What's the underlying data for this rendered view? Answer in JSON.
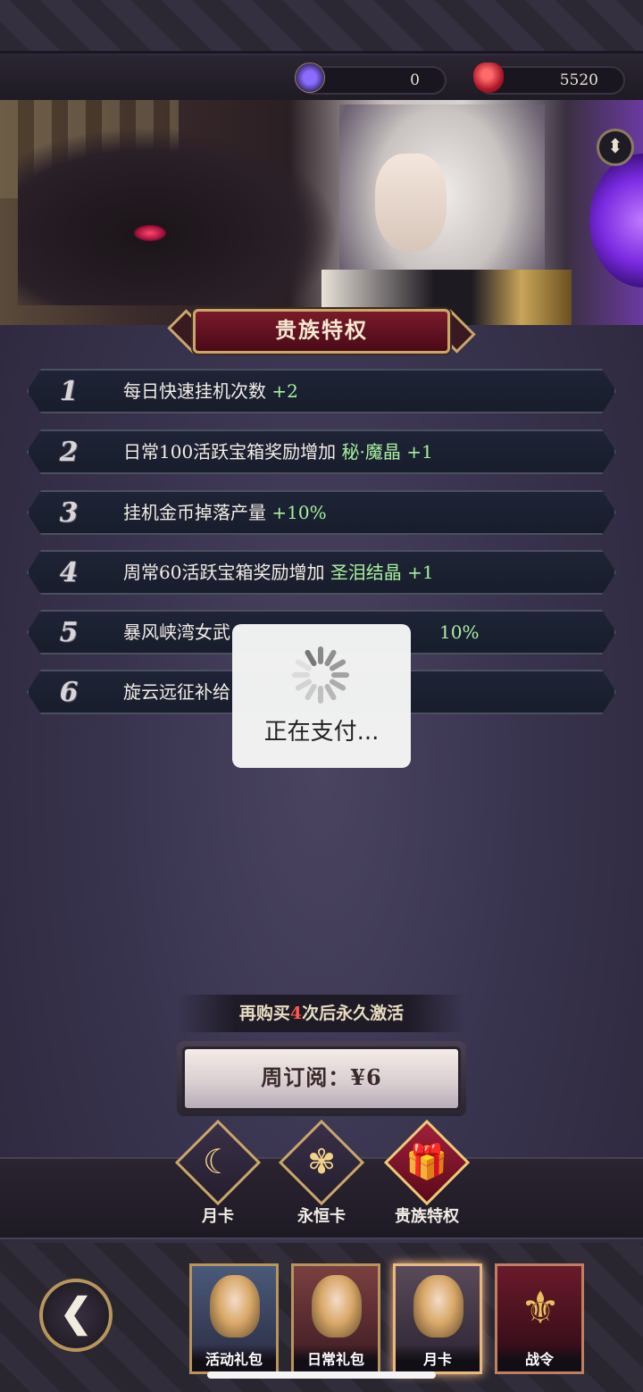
{
  "currency": {
    "gem_purple": {
      "value": "0",
      "icon": "purple-orb-icon"
    },
    "gem_red": {
      "value": "5520",
      "icon": "red-crystal-icon"
    }
  },
  "info_icon": "⬍",
  "title": "贵族特权",
  "privileges": [
    {
      "num": "1",
      "text": "每日快速挂机次数 ",
      "highlight": "+2"
    },
    {
      "num": "2",
      "text": "日常100活跃宝箱奖励增加 ",
      "highlight": "秘·魔晶 +1"
    },
    {
      "num": "3",
      "text": "挂机金币掉落产量 ",
      "highlight": "+10%"
    },
    {
      "num": "4",
      "text": "周常60活跃宝箱奖励增加 ",
      "highlight": "圣泪结晶 +1"
    },
    {
      "num": "5",
      "text": "暴风峡湾女武",
      "highlight": "10%"
    },
    {
      "num": "6",
      "text": "旋云远征补给",
      "highlight": ""
    }
  ],
  "loading": {
    "text": "正在支付..."
  },
  "purchase": {
    "remain_prefix": "再购买",
    "remain_count": "4",
    "remain_suffix": "次后永久激活",
    "button_label": "周订阅：¥6"
  },
  "card_tabs": [
    {
      "label": "月卡",
      "glyph": "☾",
      "active": false
    },
    {
      "label": "永恒卡",
      "glyph": "✾",
      "active": false
    },
    {
      "label": "贵族特权",
      "glyph": "🎁",
      "active": true
    }
  ],
  "back_glyph": "❮",
  "bottom_nav": [
    {
      "label": "活动礼包"
    },
    {
      "label": "日常礼包"
    },
    {
      "label": "月卡"
    },
    {
      "label": "战令"
    }
  ],
  "colors": {
    "highlight_green": "#a8f0a0",
    "accent_gold": "#c9a66a",
    "count_red": "#ff5a4a"
  }
}
